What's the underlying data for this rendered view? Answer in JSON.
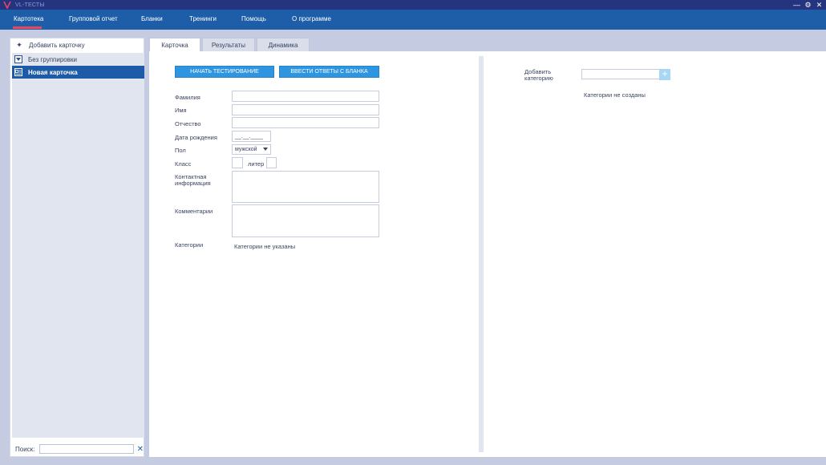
{
  "app": {
    "title": "VL-ТЕСТЫ",
    "controls": {
      "minimize": "—",
      "settings": "⚙",
      "close": "✕"
    }
  },
  "menu": {
    "items": [
      "Картотека",
      "Групповой отчет",
      "Бланки",
      "Тренинги",
      "Помощь",
      "О программе"
    ],
    "active": "Картотека"
  },
  "sidebar": {
    "add_card": "Добавить карточку",
    "group": "Без группировки",
    "card": "Новая карточка",
    "search_label": "Поиск:",
    "search_value": ""
  },
  "tabs": [
    "Карточка",
    "Результаты",
    "Динамика"
  ],
  "buttons": {
    "start_test": "НАЧАТЬ ТЕСТИРОВАНИЕ",
    "enter_answers": "ВВЕСТИ ОТВЕТЫ С БЛАНКА"
  },
  "form": {
    "surname_label": "Фамилия",
    "name_label": "Имя",
    "patronymic_label": "Отчество",
    "birthdate_label": "Дата рождения",
    "birthdate_value": "__.__.____",
    "gender_label": "Пол",
    "gender_value": "мужской",
    "class_label": "Класс",
    "letter_label": "литер",
    "contact_label_1": "Контактная",
    "contact_label_2": "информация",
    "comments_label": "Комментарии",
    "categories_label": "Категории",
    "categories_value": "Категории не указаны"
  },
  "categories": {
    "add_label_1": "Добавить",
    "add_label_2": "категорию",
    "empty": "Категории не созданы"
  }
}
